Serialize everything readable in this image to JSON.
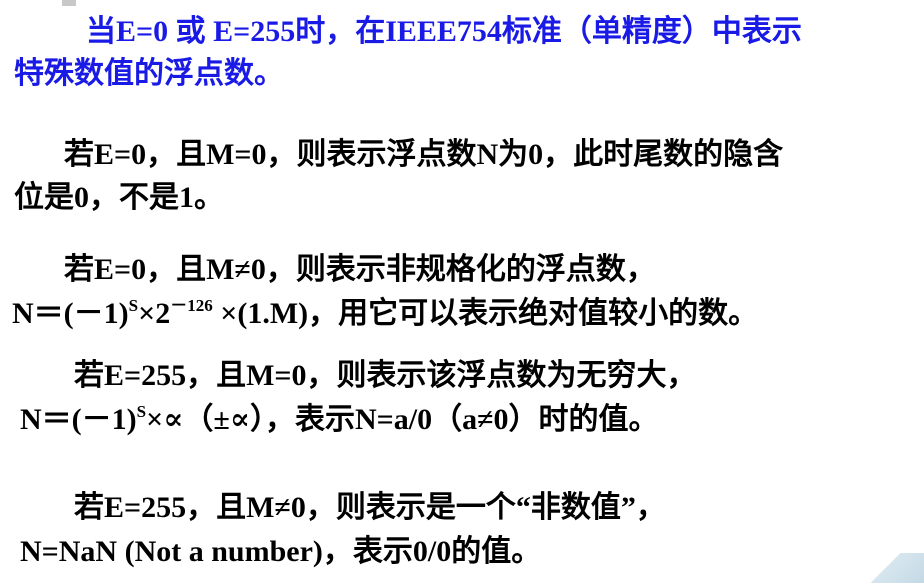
{
  "intro": {
    "line1": "当E=0 或  E=255时，在IEEE754标准（单精度）中表示",
    "line2": "特殊数值的浮点数。"
  },
  "case1": {
    "line1": "若E=0，且M=0，则表示浮点数N为0，此时尾数的隐含",
    "line2": "位是0，不是1。"
  },
  "case2": {
    "line1": "若E=0，且M≠0，则表示非规格化的浮点数，",
    "formula_prefix": "N＝(－1)",
    "formula_sup1": "S",
    "formula_mid": "×2",
    "formula_sup2": "－126",
    "formula_suffix": " ×(1.M)，用它可以表示绝对值较小的数。"
  },
  "case3": {
    "line1": "若E=255，且M=0，则表示该浮点数为无穷大，",
    "formula_prefix": "N＝(－1)",
    "formula_sup": "S",
    "formula_suffix": "×∝（±∝），表示N=a/0（a≠0）时的值。"
  },
  "case4": {
    "line1": "若E=255，且M≠0，则表示是一个“非数值”，",
    "line2": "N=NaN (Not a number)，表示0/0的值。"
  }
}
